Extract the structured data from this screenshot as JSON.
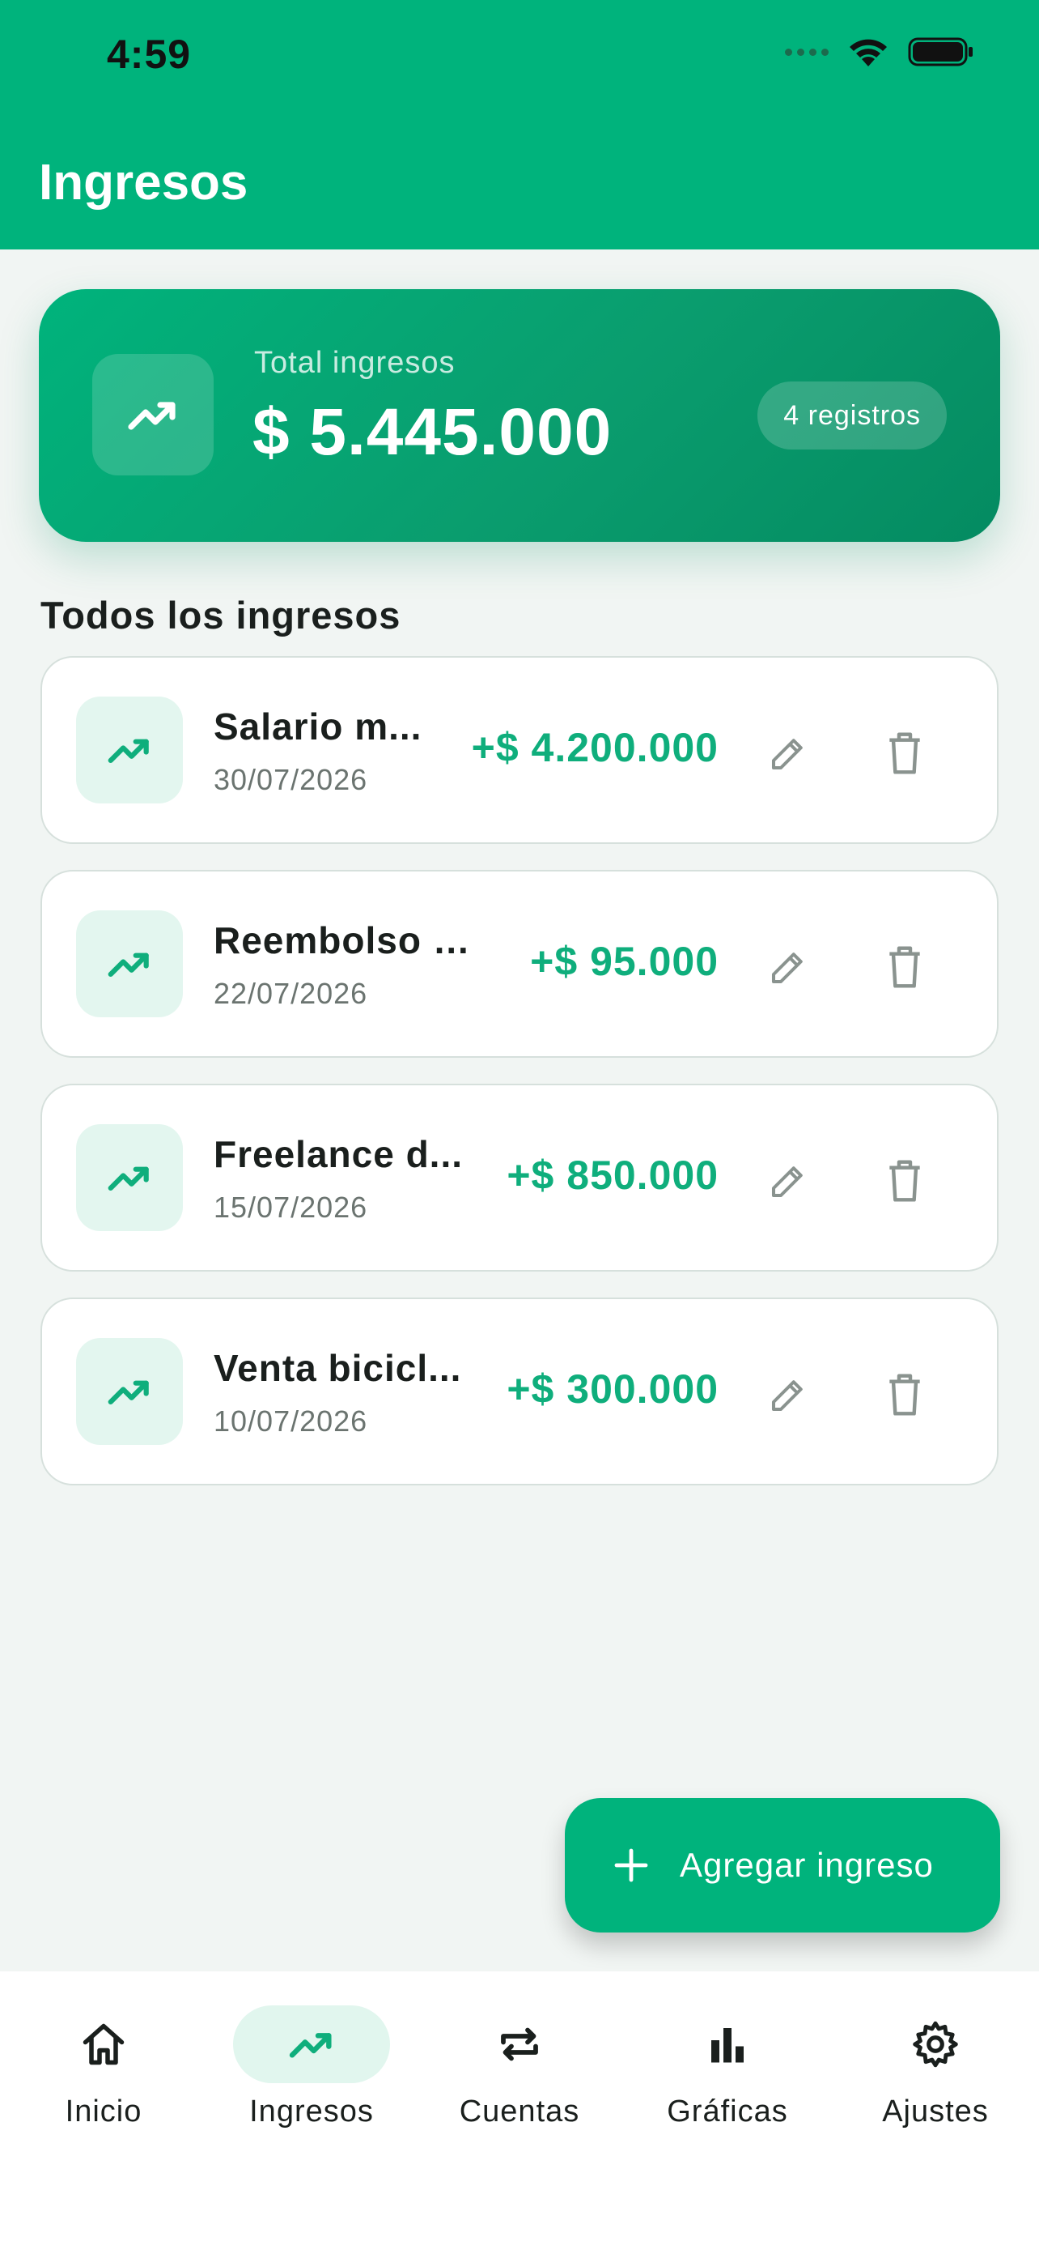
{
  "status_bar": {
    "time": "4:59"
  },
  "header": {
    "title": "Ingresos"
  },
  "summary": {
    "label": "Total ingresos",
    "amount": "$ 5.445.000",
    "badge": "4 registros"
  },
  "section": {
    "title": "Todos los ingresos"
  },
  "incomes": [
    {
      "name": "Salario m...",
      "date": "30/07/2026",
      "amount": "+$ 4.200.000"
    },
    {
      "name": "Reembolso E...",
      "date": "22/07/2026",
      "amount": "+$ 95.000"
    },
    {
      "name": "Freelance d...",
      "date": "15/07/2026",
      "amount": "+$ 850.000"
    },
    {
      "name": "Venta bicicl...",
      "date": "10/07/2026",
      "amount": "+$ 300.000"
    }
  ],
  "fab": {
    "label": "Agregar ingreso"
  },
  "nav": [
    {
      "label": "Inicio",
      "icon": "home-icon"
    },
    {
      "label": "Ingresos",
      "icon": "trending-up-icon",
      "active": true
    },
    {
      "label": "Cuentas",
      "icon": "repeat-icon"
    },
    {
      "label": "Gráficas",
      "icon": "bar-chart-icon"
    },
    {
      "label": "Ajustes",
      "icon": "gear-icon"
    }
  ],
  "colors": {
    "primary": "#00b37c",
    "amount_green": "#0fae7c",
    "background": "#f1f5f3",
    "icon_muted": "#8a938f"
  }
}
